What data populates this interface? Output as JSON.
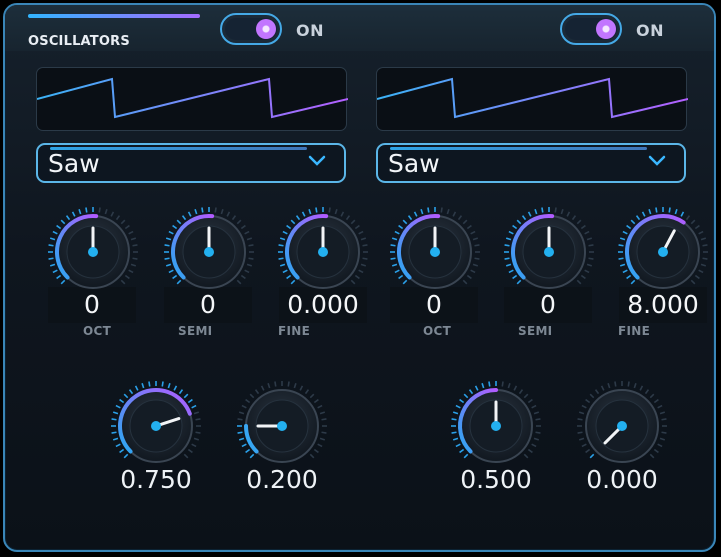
{
  "section": {
    "title": "OSCILLATORS"
  },
  "colors": {
    "accent_blue": "#31b5ff",
    "accent_purple": "#b36bff",
    "border": "#3a86b8"
  },
  "osc1": {
    "enabled": true,
    "toggle_label": "ON",
    "waveform": "Saw",
    "knobs": [
      {
        "label": "OCT",
        "value": "0"
      },
      {
        "label": "SEMI",
        "value": "0"
      },
      {
        "label": "FINE",
        "value": "0.000"
      }
    ],
    "lower_knobs": [
      {
        "value": "0.750"
      },
      {
        "value": "0.200"
      }
    ]
  },
  "osc2": {
    "enabled": true,
    "toggle_label": "ON",
    "waveform": "Saw",
    "knobs": [
      {
        "label": "OCT",
        "value": "0"
      },
      {
        "label": "SEMI",
        "value": "0"
      },
      {
        "label": "FINE",
        "value": "8.000"
      }
    ],
    "lower_knobs": [
      {
        "value": "0.500"
      },
      {
        "value": "0.000"
      }
    ]
  }
}
